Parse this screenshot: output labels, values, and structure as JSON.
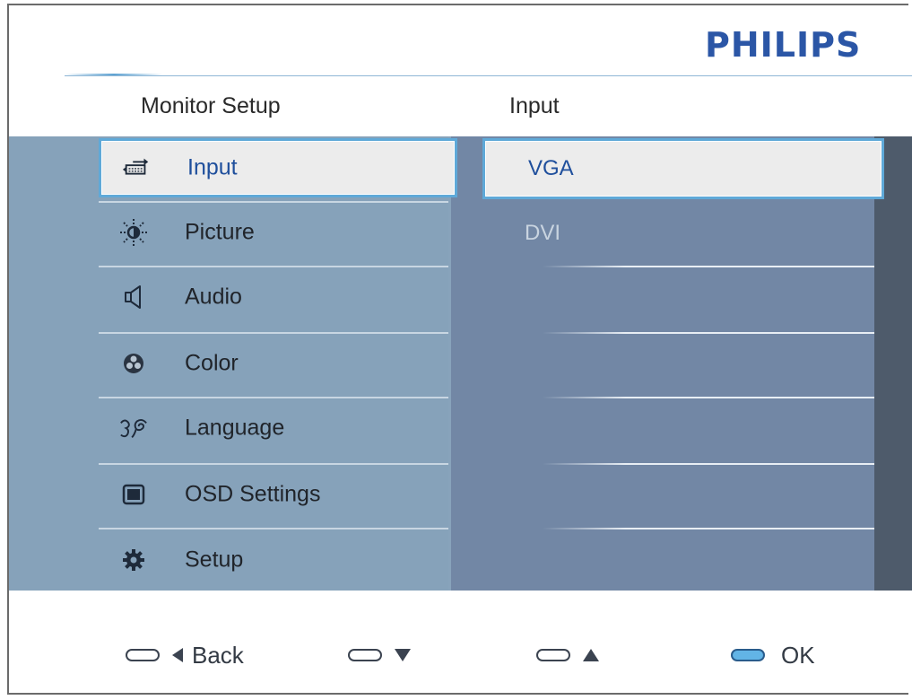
{
  "brand": {
    "logo_text": "PHILIPS",
    "color": "#2b56a6"
  },
  "columns": {
    "left_title": "Monitor Setup",
    "right_title": "Input"
  },
  "menu": {
    "items": [
      {
        "label": "Input",
        "icon": "input-icon",
        "selected": true
      },
      {
        "label": "Picture",
        "icon": "picture-icon",
        "selected": false
      },
      {
        "label": "Audio",
        "icon": "audio-icon",
        "selected": false
      },
      {
        "label": "Color",
        "icon": "color-icon",
        "selected": false
      },
      {
        "label": "Language",
        "icon": "language-icon",
        "selected": false
      },
      {
        "label": "OSD Settings",
        "icon": "osd-settings-icon",
        "selected": false
      },
      {
        "label": "Setup",
        "icon": "setup-icon",
        "selected": false
      }
    ]
  },
  "submenu": {
    "items": [
      {
        "label": "VGA",
        "selected": true
      },
      {
        "label": "DVI",
        "selected": false
      }
    ]
  },
  "footer": {
    "back_label": "Back",
    "down_label": "",
    "up_label": "",
    "ok_label": "OK"
  },
  "colors": {
    "accent": "#5fa9d8",
    "selected_text": "#1f4f9c",
    "left_panel": "#86a2ba",
    "right_panel": "#7287a5"
  }
}
